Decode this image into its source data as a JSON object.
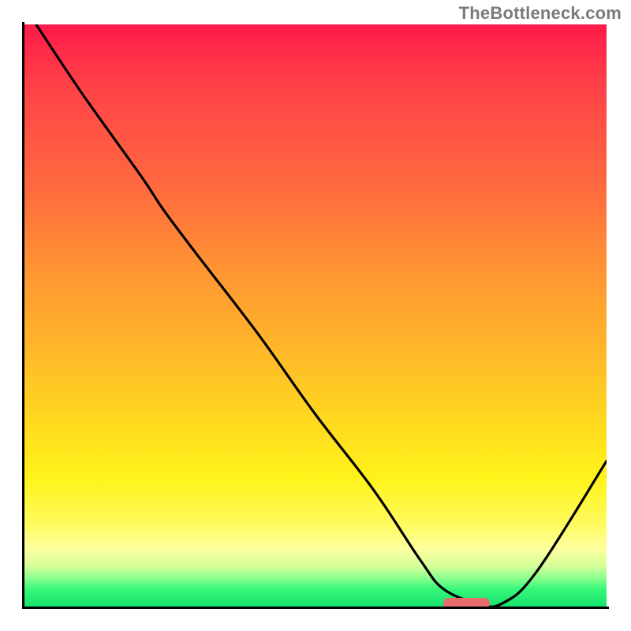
{
  "watermark": "TheBottleneck.com",
  "chart_data": {
    "type": "line",
    "title": "",
    "xlabel": "",
    "ylabel": "",
    "xlim": [
      0,
      100
    ],
    "ylim": [
      0,
      100
    ],
    "grid": false,
    "legend": false,
    "background": {
      "type": "vertical_gradient",
      "stops": [
        {
          "pos": 0,
          "color": "#ff1a49"
        },
        {
          "pos": 40,
          "color": "#ff8f35"
        },
        {
          "pos": 70,
          "color": "#ffe41f"
        },
        {
          "pos": 90,
          "color": "#feffa0"
        },
        {
          "pos": 100,
          "color": "#16e36e"
        }
      ]
    },
    "series": [
      {
        "name": "bottleneck-curve",
        "color": "#000000",
        "x": [
          2,
          10,
          20,
          24,
          30,
          40,
          50,
          60,
          68,
          72,
          78,
          82,
          88,
          100
        ],
        "y": [
          100,
          88,
          74,
          68,
          60,
          47,
          33,
          20,
          8,
          3,
          0.5,
          0.5,
          6,
          25
        ]
      }
    ],
    "marker": {
      "name": "optimal-range",
      "color": "#e86b6d",
      "x_start": 72,
      "x_end": 80,
      "y": 0.5
    }
  }
}
